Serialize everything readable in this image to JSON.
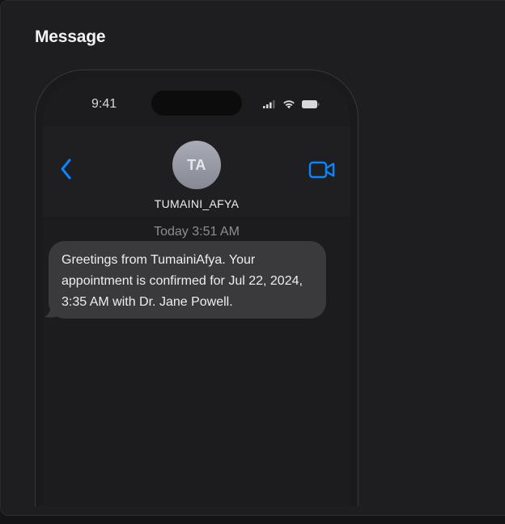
{
  "panel": {
    "title": "Message"
  },
  "status_bar": {
    "time": "9:41"
  },
  "contact": {
    "initials": "TA",
    "name": "TUMAINI_AFYA"
  },
  "thread": {
    "timestamp": "Today 3:51 AM",
    "message": "Greetings from TumainiAfya. Your appointment is confirmed for Jul 22, 2024, 3:35 AM with Dr. Jane Powell."
  },
  "icons": {
    "back": "chevron-left-icon",
    "video": "video-camera-icon",
    "signal": "cellular-signal-icon",
    "wifi": "wifi-icon",
    "battery": "battery-icon"
  },
  "colors": {
    "accent": "#0a84ff",
    "bubble": "#3a3a3c",
    "avatar": "#9a9da7"
  }
}
